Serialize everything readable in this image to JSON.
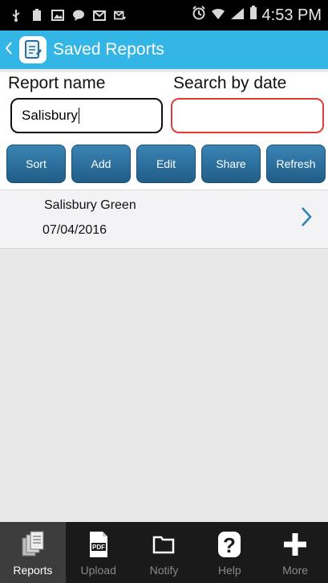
{
  "status_bar": {
    "time": "4:53 PM"
  },
  "app_bar": {
    "title": "Saved Reports"
  },
  "search": {
    "report_name_label": "Report name",
    "date_label": "Search by date",
    "report_name_value": "Salisbury",
    "date_value": ""
  },
  "toolbar": {
    "sort_label": "Sort",
    "add_label": "Add",
    "edit_label": "Edit",
    "share_label": "Share",
    "refresh_label": "Refresh"
  },
  "reports": [
    {
      "name": "Salisbury Green",
      "date": "07/04/2016"
    }
  ],
  "tabs": [
    {
      "label": "Reports",
      "icon": "reports-icon",
      "active": true
    },
    {
      "label": "Upload",
      "icon": "pdf-upload-icon",
      "active": false
    },
    {
      "label": "Notify",
      "icon": "folder-icon",
      "active": false
    },
    {
      "label": "Help",
      "icon": "help-icon",
      "active": false
    },
    {
      "label": "More",
      "icon": "plus-icon",
      "active": false
    }
  ],
  "colors": {
    "app_bar": "#33b5e5",
    "button": "#2c6f9c",
    "date_border": "#e23a3a"
  }
}
